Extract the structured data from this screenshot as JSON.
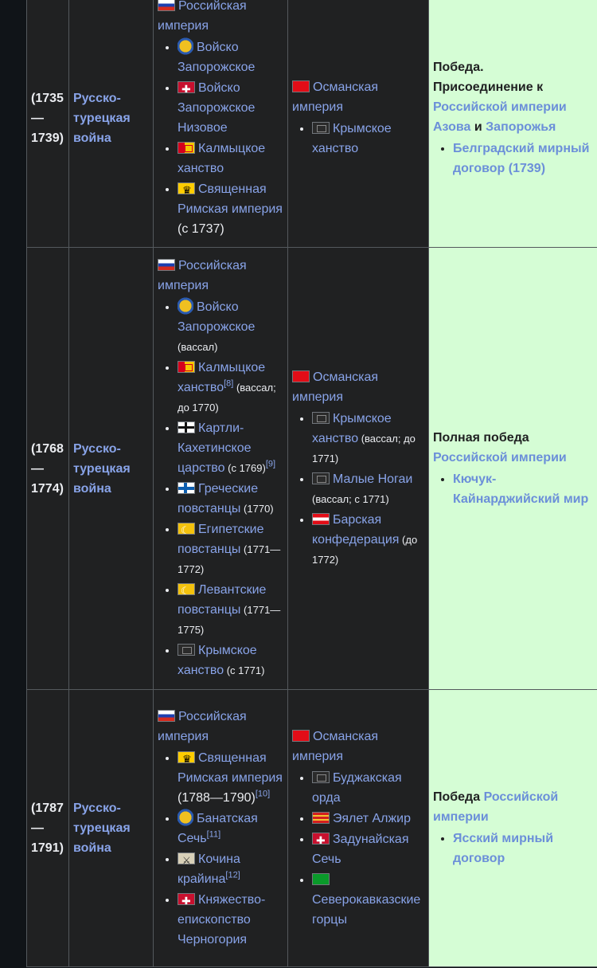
{
  "rows": [
    {
      "date": [
        "(1735",
        "—",
        "1739)"
      ],
      "name": "Русско-турецкая война",
      "side1_head": "Российская империя",
      "side1": [
        {
          "flag": "zap",
          "text": "Войско Запорожское",
          "note": ""
        },
        {
          "flag": "nizov",
          "text": "Войско Запорожское Низовое",
          "note": ""
        },
        {
          "flag": "kalm",
          "text": "Калмыцкое ханство",
          "note": ""
        },
        {
          "flag": "hre",
          "text": "Священная Римская империя",
          "note": " (с 1737)"
        }
      ],
      "side2_head": "Османская империя",
      "side2": [
        {
          "flag": "krym",
          "text": "Крымское ханство",
          "note": ""
        }
      ],
      "result": {
        "line1": "Победа.",
        "line2": "Присоединение к",
        "link1": "Российской империи",
        "link2": "Азова",
        "and": "и",
        "link3": "Запорожья",
        "bullet": "Белградский мирный договор (1739)"
      }
    },
    {
      "date": [
        "(1768",
        "—",
        "1774)"
      ],
      "name": "Русско-турецкая война",
      "side1_head": "Российская империя",
      "side1": [
        {
          "flag": "zap",
          "text": "Войско Запорожское",
          "note": "(вассал)"
        },
        {
          "flag": "kalm",
          "text": "Калмыцкое ханство",
          "sup": "[8]",
          "note": " (вассал; до 1770)"
        },
        {
          "flag": "kart",
          "text": "Картли-Кахетинское царство",
          "note": " (с 1769)",
          "sup2": "[9]"
        },
        {
          "flag": "greek",
          "text": "Греческие повстанцы",
          "note": " (1770)"
        },
        {
          "flag": "egypt",
          "text": "Египетские повстанцы",
          "note": " (1771—1772)"
        },
        {
          "flag": "egypt",
          "text": "Левантские повстанцы",
          "note": " (1771—1775)"
        },
        {
          "flag": "krym",
          "text": "Крымское ханство",
          "note": " (с 1771)"
        }
      ],
      "side2_head": "Османская империя",
      "side2": [
        {
          "flag": "krym",
          "text": "Крымское ханство",
          "note": " (вассал; до 1771)"
        },
        {
          "flag": "mnog",
          "text": "Малые Ногаи",
          "note": " (вассал; с 1771)"
        },
        {
          "flag": "bar",
          "text": "Барская конфедерация",
          "note": " (до 1772)"
        }
      ],
      "result": {
        "line1": "Полная победа",
        "link1": "Российской империи",
        "bullet": "Кючук-Кайнарджийский мир"
      }
    },
    {
      "date": [
        "(1787",
        "—",
        "1791)"
      ],
      "name": "Русско-турецкая война",
      "side1_head": "Российская империя",
      "side1": [
        {
          "flag": "hre",
          "text": "Священная Римская империя",
          "note": " (1788—1790)",
          "sup": "[10]"
        },
        {
          "flag": "banat",
          "text": "Банатская Сечь",
          "sup": "[11]",
          "note": ""
        },
        {
          "flag": "koch",
          "text": "Кочина крайина",
          "sup": "[12]",
          "note": ""
        },
        {
          "flag": "monte",
          "text": "Княжество-епископство Черногория",
          "note": ""
        }
      ],
      "side2_head": "Османская империя",
      "side2": [
        {
          "flag": "krym",
          "text": "Буджакская орда",
          "note": ""
        },
        {
          "flag": "alg",
          "text": "Эялет Алжир",
          "note": ""
        },
        {
          "flag": "zadun",
          "text": "Задунайская Сечь",
          "note": ""
        },
        {
          "flag": "green",
          "text": "Северокавказские горцы",
          "note": ""
        }
      ],
      "result": {
        "line1": "Победа",
        "link1": "Российской империи",
        "bullet": "Ясский мирный договор"
      }
    }
  ]
}
